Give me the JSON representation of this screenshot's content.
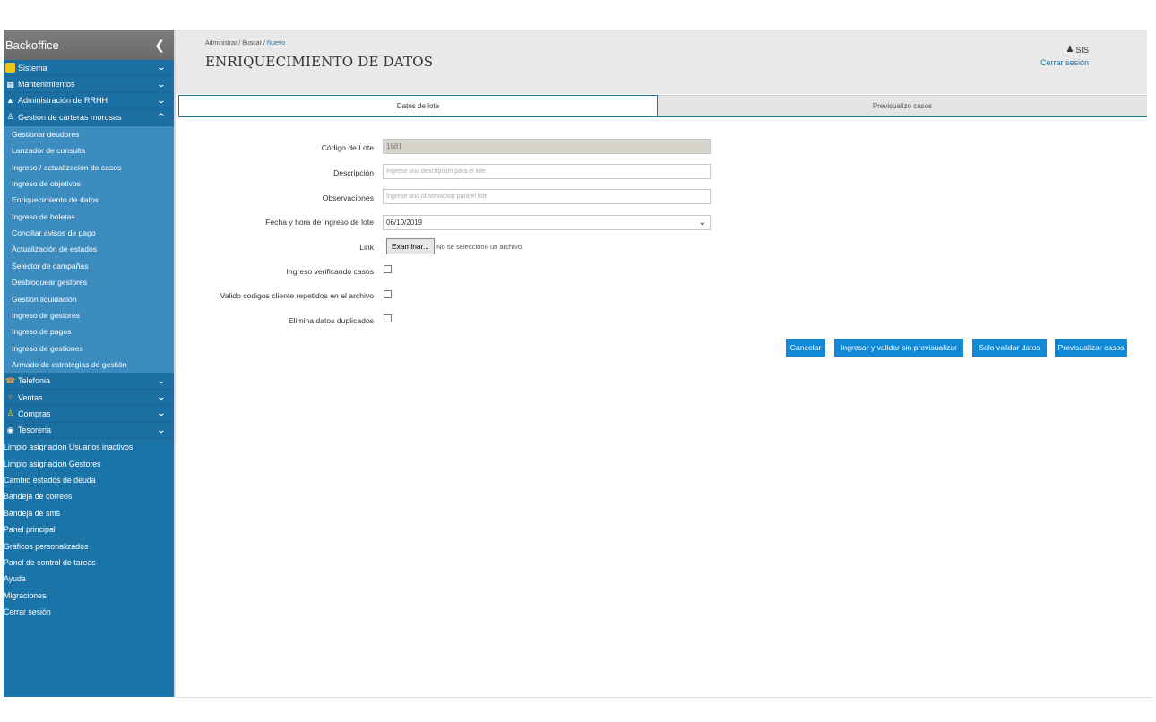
{
  "sidebar": {
    "title": "Backoffice",
    "collapse_icon": "chevron-left-icon",
    "main_items": [
      {
        "label": "Sistema",
        "icon": "sistema-icon",
        "expanded": false
      },
      {
        "label": "Mantenimientos",
        "icon": "mantenimientos-icon",
        "expanded": false
      },
      {
        "label": "Administración de RRHH",
        "icon": "rrhh-icon",
        "expanded": false
      },
      {
        "label": "Gestion de carteras morosas",
        "icon": "carteras-icon",
        "expanded": true
      }
    ],
    "sub_items": [
      "Gestionar deudores",
      "Lanzador de consulta",
      "Ingreso / actualización de casos",
      "Ingreso de objetivos",
      "Enriquecimiento de datos",
      "Ingreso de boletas",
      "Conciliar avisos de pago",
      "Actualización de estados",
      "Selector de campañas",
      "Desbloquear gestores",
      "Gestión liquidación",
      "Ingreso de gestores",
      "Ingreso de pagos",
      "Ingreso de gestiones",
      "Armado de estrategias de gestión"
    ],
    "main_items_2": [
      {
        "label": "Telefonia",
        "icon": "phone-icon"
      },
      {
        "label": "Ventas",
        "icon": "ventas-icon"
      },
      {
        "label": "Compras",
        "icon": "compras-icon"
      },
      {
        "label": "Tesoreria",
        "icon": "money-bag-icon"
      }
    ],
    "plain_items": [
      "Limpio asignacion Usuarios inactivos",
      "Limpio asignacion Gestores",
      "Cambio estados de deuda",
      "Bandeja de correos",
      "Bandeja de sms",
      "Panel principal",
      "Gráficos personalizados",
      "Panel de control de tareas",
      "Ayuda",
      "Migraciones",
      "Cerrar sesión"
    ]
  },
  "header": {
    "breadcrumb": {
      "part1": "Administrar",
      "part2": "Buscar",
      "active": "Nuevo",
      "separator": " / "
    },
    "title": "ENRIQUECIMIENTO DE DATOS",
    "user": "SIS",
    "logout": "Cerrar sesión"
  },
  "tabs": {
    "active": "Datos de lote",
    "inactive": "Previsualizo casos"
  },
  "form": {
    "codigo_label": "Código de Lote",
    "codigo_value": "1681",
    "descripcion_label": "Descripción",
    "descripcion_placeholder": "Ingrese una descripcion para el lote",
    "observaciones_label": "Observaciones",
    "observaciones_placeholder": "Ingrese una observacion para el lote",
    "fecha_label": "Fecha y hora de ingreso de lote",
    "fecha_value": "06/10/2019",
    "link_label": "Link",
    "file_button": "Examinar...",
    "file_status": "No se seleccionó un archivo.",
    "check1_label": "Ingreso verificando casos",
    "check2_label": "Valido codigos cliente repetidos en el archivo",
    "check3_label": "Elimina datos duplicados"
  },
  "buttons": {
    "cancel": "Cancelar",
    "ingresar": "Ingresar y validar sin previsualizar",
    "validar": "Solo validar datos",
    "previsualizar": "Previsualizar casos"
  },
  "colors": {
    "sidebar": "#1b74a8",
    "submenu": "#3d8cc0",
    "accent": "#1289d6",
    "header_bg": "#e9e9e9"
  }
}
